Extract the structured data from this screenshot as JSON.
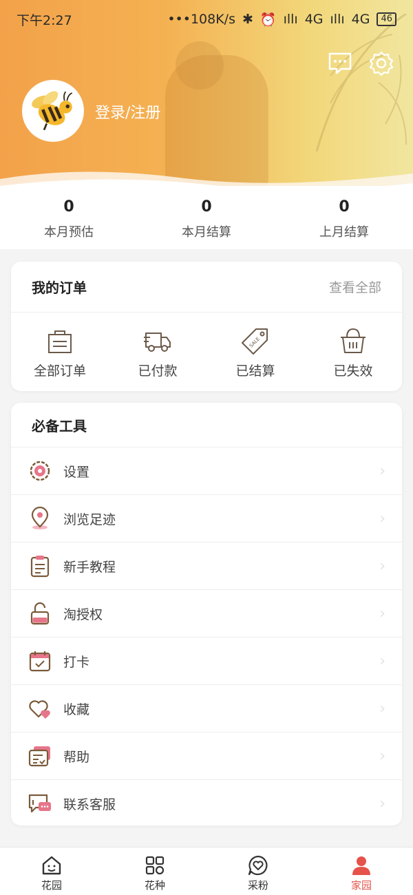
{
  "status_bar": {
    "time": "下午2:27",
    "speed": "•••108K/s",
    "network1": "4G",
    "network2": "4G",
    "battery": "46"
  },
  "profile": {
    "login_label": "登录/注册"
  },
  "stats": [
    {
      "value": "0",
      "label": "本月预估"
    },
    {
      "value": "0",
      "label": "本月结算"
    },
    {
      "value": "0",
      "label": "上月结算"
    }
  ],
  "orders": {
    "title": "我的订单",
    "view_all": "查看全部",
    "items": [
      {
        "label": "全部订单",
        "icon": "shopping-bag-icon"
      },
      {
        "label": "已付款",
        "icon": "delivery-truck-icon"
      },
      {
        "label": "已结算",
        "icon": "sale-tag-icon"
      },
      {
        "label": "已失效",
        "icon": "basket-icon"
      }
    ]
  },
  "tools": {
    "title": "必备工具",
    "items": [
      {
        "label": "设置",
        "icon": "settings-gear-icon"
      },
      {
        "label": "浏览足迹",
        "icon": "location-pin-icon"
      },
      {
        "label": "新手教程",
        "icon": "clipboard-icon"
      },
      {
        "label": "淘授权",
        "icon": "unlock-icon"
      },
      {
        "label": "打卡",
        "icon": "calendar-check-icon"
      },
      {
        "label": "收藏",
        "icon": "heart-icon"
      },
      {
        "label": "帮助",
        "icon": "help-card-icon"
      },
      {
        "label": "联系客服",
        "icon": "chat-service-icon"
      }
    ]
  },
  "bottom_nav": {
    "items": [
      {
        "label": "花园",
        "icon": "home-icon"
      },
      {
        "label": "花种",
        "icon": "grid-icon"
      },
      {
        "label": "采粉",
        "icon": "chat-heart-icon"
      },
      {
        "label": "家园",
        "icon": "person-icon"
      }
    ],
    "active": "家园"
  },
  "colors": {
    "header_start": "#f3a24a",
    "header_end": "#f1e6a0",
    "accent_red": "#e5534b",
    "icon_brown": "#7a5a3a",
    "icon_pink": "#e7758a"
  }
}
